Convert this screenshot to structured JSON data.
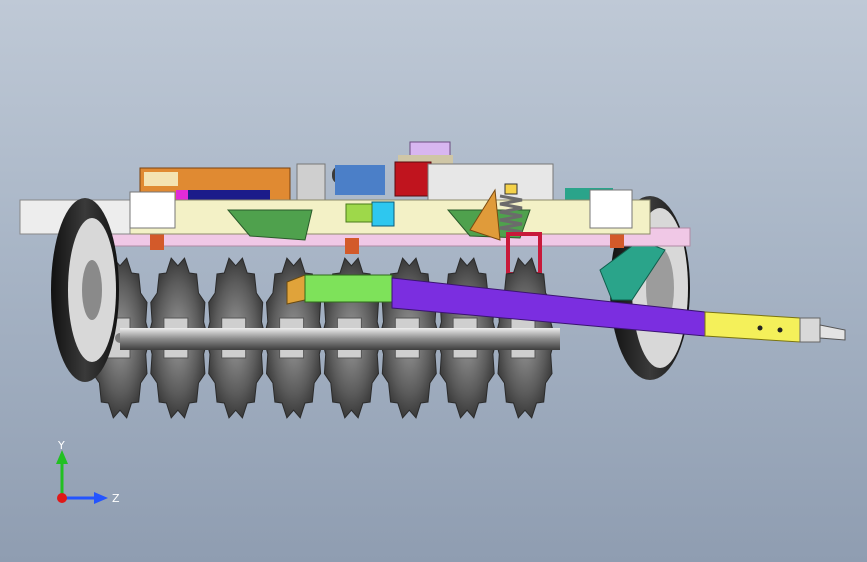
{
  "viewport": {
    "background_top": "#bfc9d6",
    "background_bottom": "#8f9db1"
  },
  "model": {
    "subject": "disc-harrow-assembly",
    "disc_count": 8,
    "part_colors": {
      "frame": "#f3f1c6",
      "tow_bar": "#7b2ee0",
      "tow_bar_front": "#7ee25a",
      "tow_bar_tip": "#f4f05a",
      "gearbox": "#e08a32",
      "red_block": "#c0141e",
      "cyan_block": "#2ec7ef",
      "teal_strut": "#2aa48a",
      "discs": "#5b5b5b",
      "tyre": "#222222",
      "wheel_rim": "#dcdcdc",
      "pink_rail": "#f0c8e6",
      "lavender_top": "#d8b6f0"
    }
  },
  "triad": {
    "y_label": "Y",
    "z_label": "Z",
    "y_color": "#22c022",
    "z_color": "#2454ff",
    "x_color": "#e01818"
  }
}
